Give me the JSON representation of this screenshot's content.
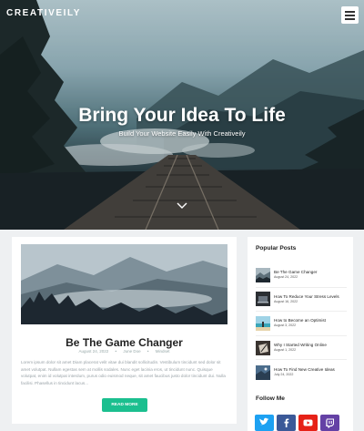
{
  "site": {
    "logo": "CREATIVEILY"
  },
  "hero": {
    "title": "Bring Your Idea To Life",
    "subtitle": "Build Your Website Easily With Creativeily"
  },
  "post": {
    "title": "Be The Game Changer",
    "date": "August 24, 2022",
    "author": "June Doe",
    "category": "Mindset",
    "excerpt": "Lorem ipsum dolor sit amet Diam placerat velit vitae dui blandit sollicitudin. Vestibulum tincidunt sed dolor sit amet volutpat. Nullam egestas sem at mollis sodales. Nunc eget lacinia eros, ut tincidunt nunc. Quisque volutpat, enim id volutpat interdum, purus odio euismod neque, sit amet faucibus justo dolor tincidunt dui. Nulla facilisi. Phasellus in tincidunt lacus...",
    "read_more_label": "READ MORE"
  },
  "sidebar": {
    "popular_heading": "Popular Posts",
    "popular_posts": [
      {
        "title": "Be The Game Changer",
        "date": "August 24, 2022",
        "thumb": "mountains"
      },
      {
        "title": "How To Reduce Your Stress Levels",
        "date": "August 16, 2022",
        "thumb": "laptop-desk"
      },
      {
        "title": "How to Become an Optimist",
        "date": "August 3, 2022",
        "thumb": "beach"
      },
      {
        "title": "Why I Started Writing Online",
        "date": "August 1, 2022",
        "thumb": "writing"
      },
      {
        "title": "How To Find New Creative Ideas",
        "date": "July 24, 2022",
        "thumb": "landscape"
      }
    ],
    "follow_heading": "Follow Me",
    "social": [
      {
        "name": "twitter-icon",
        "color": "#1da1f2"
      },
      {
        "name": "facebook-icon",
        "color": "#3b5998"
      },
      {
        "name": "youtube-icon",
        "color": "#e62117"
      },
      {
        "name": "twitch-icon",
        "color": "#6441a5"
      }
    ]
  }
}
